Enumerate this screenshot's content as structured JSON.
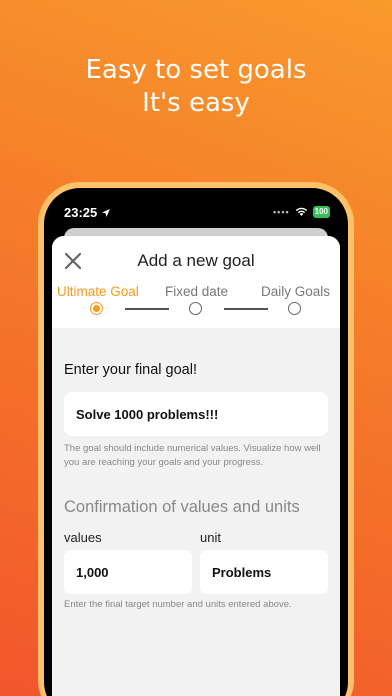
{
  "headline": {
    "line1": "Easy to set goals",
    "line2": "It's easy"
  },
  "status_bar": {
    "time": "23:25",
    "battery": "100",
    "icons": [
      "location-arrow-icon",
      "wifi-icon",
      "battery-icon"
    ]
  },
  "sheet": {
    "title": "Add a new goal",
    "close_icon": "close-icon",
    "steps": [
      {
        "label": "Ultimate Goal",
        "active": true
      },
      {
        "label": "Fixed date",
        "active": false
      },
      {
        "label": "Daily Goals",
        "active": false
      }
    ],
    "final_goal_label": "Enter your final goal!",
    "final_goal_value": "Solve 1000 problems!!!",
    "final_goal_hint": "The goal should include numerical values. Visualize how well you are reaching your goals and your progress.",
    "confirm_title": "Confirmation of values and units",
    "values_label": "values",
    "values_value": "1,000",
    "unit_label": "unit",
    "unit_value": "Problems",
    "confirm_hint": "Enter the final target number and units entered above."
  },
  "colors": {
    "accent": "#f59a1b",
    "frame": "#ffc26a"
  }
}
